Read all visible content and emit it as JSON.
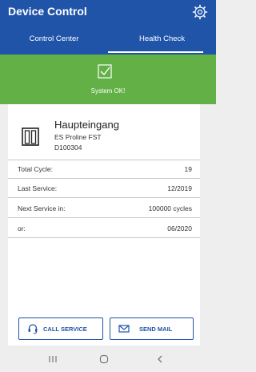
{
  "app": {
    "title": "Device Control"
  },
  "tabs": [
    {
      "label": "Control Center"
    },
    {
      "label": "Health Check"
    }
  ],
  "status": {
    "text": "System OK!"
  },
  "device": {
    "name": "Haupteingang",
    "model": "ES Proline FST",
    "id": "D100304"
  },
  "rows": [
    {
      "label": "Total Cycle:",
      "value": "19"
    },
    {
      "label": "Last Service:",
      "value": "12/2019"
    },
    {
      "label": "Next Service in:",
      "value": "100000 cycles"
    },
    {
      "label": "or:",
      "value": "06/2020"
    }
  ],
  "actions": {
    "call": "CALL SERVICE",
    "mail": "SEND MAIL"
  },
  "colors": {
    "primary": "#2054a9",
    "status_ok": "#63b146"
  },
  "icons": [
    "settings-gear-icon",
    "checkbox-check-icon",
    "door-icon",
    "phone-headset-icon",
    "mail-icon",
    "nav-recents-icon",
    "nav-home-icon",
    "nav-back-icon"
  ]
}
